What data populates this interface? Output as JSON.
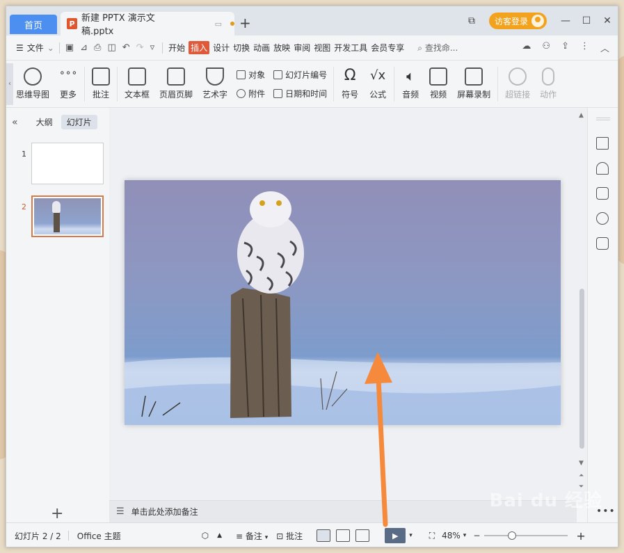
{
  "tabbar": {
    "home_label": "首页",
    "doc_title": "新建 PPTX 演示文稿.pptx",
    "add_tab": "+",
    "login_label": "访客登录"
  },
  "menu": {
    "file_label": "文件",
    "tabs": [
      "开始",
      "插入",
      "设计",
      "切换",
      "动画",
      "放映",
      "审阅",
      "视图",
      "开发工具",
      "会员专享"
    ],
    "active_tab": "插入",
    "search_placeholder": "查找命..."
  },
  "ribbon": {
    "items": [
      {
        "label": "思维导图"
      },
      {
        "label": "更多"
      },
      {
        "label": "批注"
      },
      {
        "label": "文本框"
      },
      {
        "label": "页眉页脚"
      },
      {
        "label": "艺术字"
      }
    ],
    "small": {
      "object": "对象",
      "slide_number": "幻灯片编号",
      "attachment": "附件",
      "date_time": "日期和时间"
    },
    "items2": [
      {
        "label": "符号"
      },
      {
        "label": "公式"
      },
      {
        "label": "音频"
      },
      {
        "label": "视频"
      },
      {
        "label": "屏幕录制"
      },
      {
        "label": "超链接"
      },
      {
        "label": "动作"
      }
    ]
  },
  "left_panel": {
    "collapse": "«",
    "tab_outline": "大纲",
    "tab_slides": "幻灯片",
    "thumbs": [
      {
        "num": "1"
      },
      {
        "num": "2"
      }
    ],
    "add": "+"
  },
  "notes": {
    "placeholder": "单击此处添加备注"
  },
  "status": {
    "slide_info": "幻灯片 2 / 2",
    "theme": "Office 主题",
    "notes_label": "备注",
    "comment_label": "批注",
    "zoom": "48%"
  },
  "watermark": "Bai du 经验",
  "colors": {
    "accent": "#4d8ff0",
    "insert_tab": "#e05a3a",
    "login": "#f3a21d",
    "arrow": "#f58a3c"
  }
}
